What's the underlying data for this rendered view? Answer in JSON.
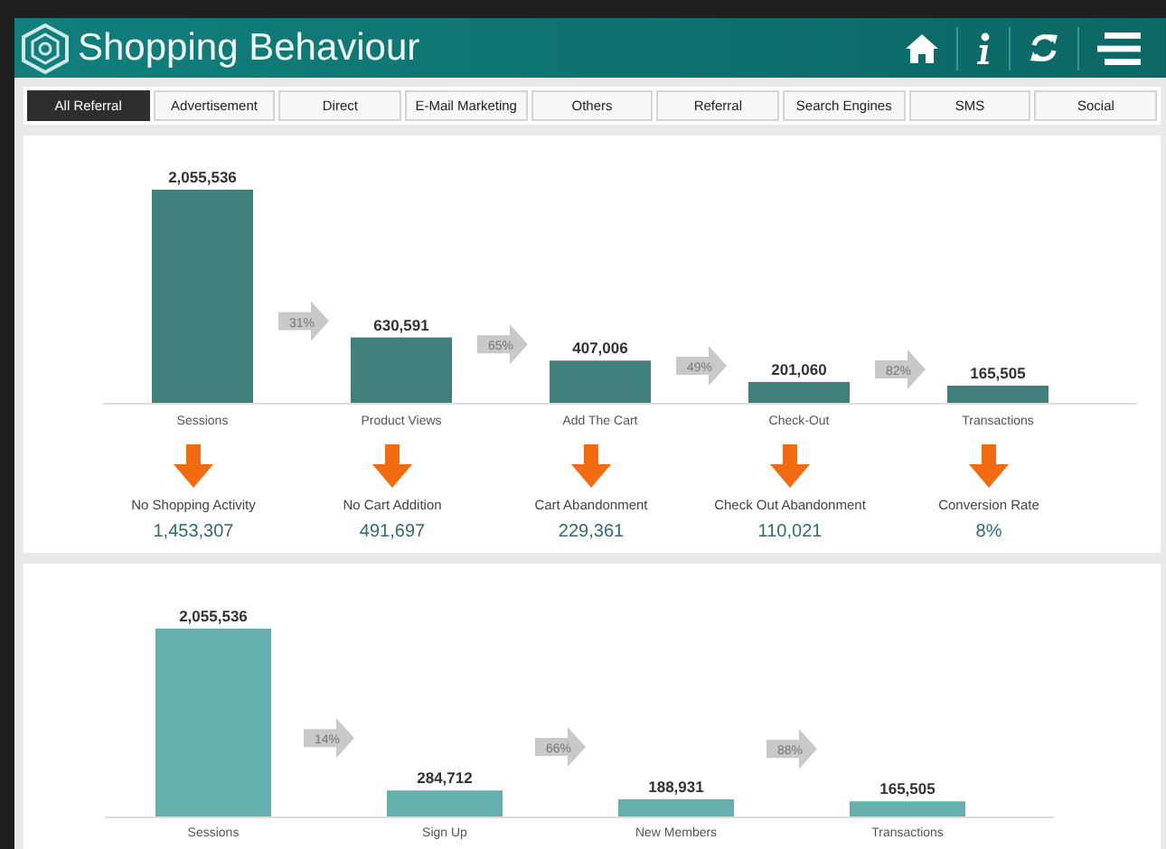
{
  "header": {
    "title": "Shopping Behaviour"
  },
  "tabs": [
    {
      "label": "All Referral",
      "selected": true
    },
    {
      "label": "Advertisement",
      "selected": false
    },
    {
      "label": "Direct",
      "selected": false
    },
    {
      "label": "E-Mail Marketing",
      "selected": false
    },
    {
      "label": "Others",
      "selected": false
    },
    {
      "label": "Referral",
      "selected": false
    },
    {
      "label": "Search Engines",
      "selected": false
    },
    {
      "label": "SMS",
      "selected": false
    },
    {
      "label": "Social",
      "selected": false
    }
  ],
  "shopping_funnel": {
    "chart_data": {
      "type": "bar",
      "categories": [
        "Sessions",
        "Product Views",
        "Add The Cart",
        "Check-Out",
        "Transactions"
      ],
      "series": [
        {
          "color": "#3f7f7c",
          "values": [
            2055536,
            630591,
            407006,
            201060,
            165505
          ],
          "value_labels": [
            "2,055,536",
            "630,591",
            "407,006",
            "201,060",
            "165,505"
          ]
        }
      ]
    },
    "step_rates": [
      "31%",
      "65%",
      "49%",
      "82%"
    ],
    "dropoffs": [
      {
        "label": "No Shopping Activity",
        "value": "1,453,307"
      },
      {
        "label": "No Cart Addition",
        "value": "491,697"
      },
      {
        "label": "Cart Abandonment",
        "value": "229,361"
      },
      {
        "label": "Check Out Abandonment",
        "value": "110,021"
      },
      {
        "label": "Conversion Rate",
        "value": "8%"
      }
    ]
  },
  "member_funnel": {
    "chart_data": {
      "type": "bar",
      "categories": [
        "Sessions",
        "Sign Up",
        "New Members",
        "Transactions"
      ],
      "series": [
        {
          "color": "#64b1ae",
          "values": [
            2055536,
            284712,
            188931,
            165505
          ],
          "value_labels": [
            "2,055,536",
            "284,712",
            "188,931",
            "165,505"
          ]
        }
      ]
    },
    "step_rates": [
      "14%",
      "66%",
      "88%"
    ]
  }
}
